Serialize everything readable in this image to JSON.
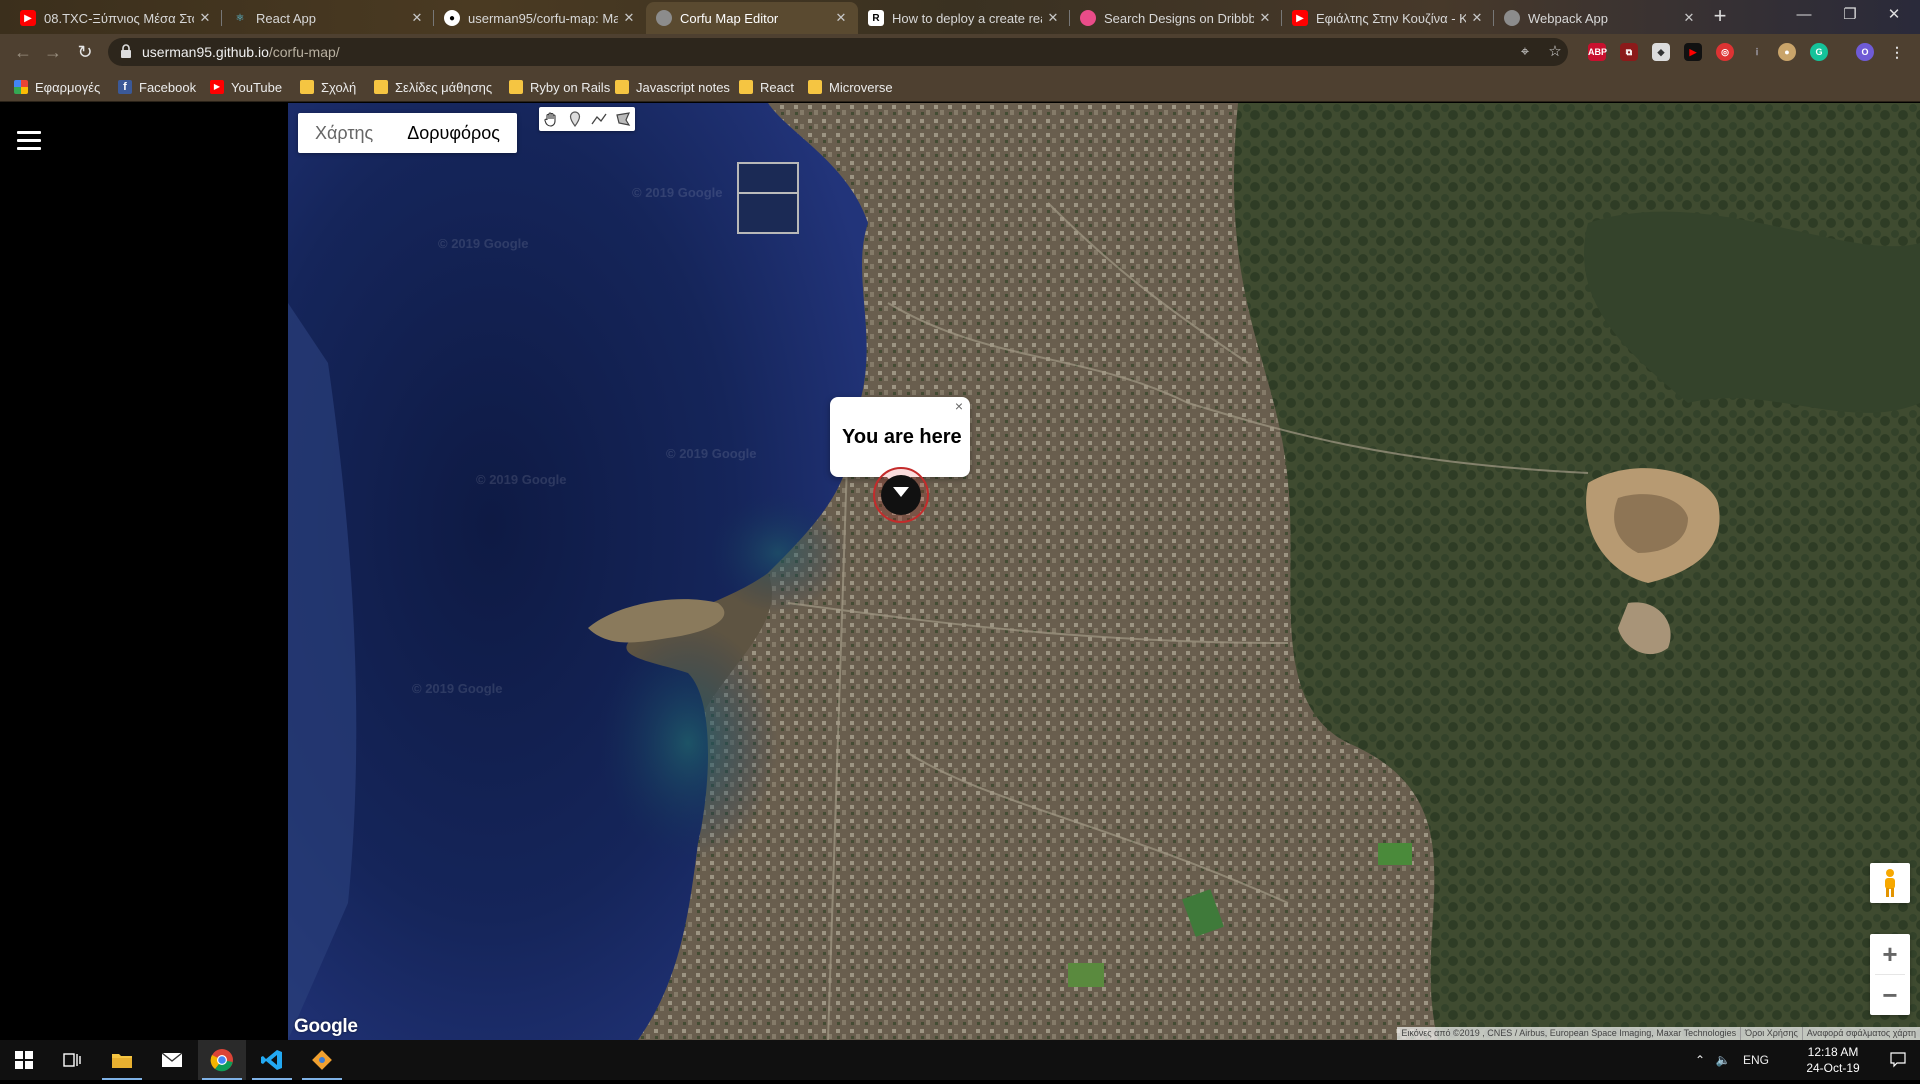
{
  "browser": {
    "tabs": [
      {
        "title": "08.TXC-Ξύπνιος Μέσα Στο",
        "favicon": "youtube-icon",
        "color": "#ff0000"
      },
      {
        "title": "React App",
        "favicon": "react-icon",
        "color": "#61dafb"
      },
      {
        "title": "userman95/corfu-map: Ma",
        "favicon": "github-icon",
        "color": "#ffffff"
      },
      {
        "title": "Corfu Map Editor",
        "favicon": "globe-icon",
        "color": "#8c8c8c"
      },
      {
        "title": "How to deploy a create rea",
        "favicon": "medium-icon",
        "color": "#000000"
      },
      {
        "title": "Search Designs on Dribbble",
        "favicon": "dribbble-icon",
        "color": "#ea4c89"
      },
      {
        "title": "Εφιάλτης Στην Κουζίνα - K",
        "favicon": "youtube-icon",
        "color": "#ff0000"
      },
      {
        "title": "Webpack App",
        "favicon": "globe-icon",
        "color": "#8c8c8c"
      }
    ],
    "active_tab_index": 3,
    "url_host": "userman95.github.io",
    "url_path": "/corfu-map/",
    "bookmarks": [
      {
        "label": "Εφαρμογές",
        "icon": "apps-grid-icon"
      },
      {
        "label": "Facebook",
        "icon": "facebook-icon"
      },
      {
        "label": "YouTube",
        "icon": "youtube-icon"
      },
      {
        "label": "Σχολή",
        "icon": "folder-icon"
      },
      {
        "label": "Σελίδες μάθησης",
        "icon": "folder-icon"
      },
      {
        "label": "Ryby on Rails",
        "icon": "folder-icon"
      },
      {
        "label": "Javascript notes",
        "icon": "folder-icon"
      },
      {
        "label": "React",
        "icon": "folder-icon"
      },
      {
        "label": "Microverse",
        "icon": "folder-icon"
      }
    ],
    "extensions": [
      "ABP",
      "pdf",
      "cube",
      "yt",
      "red",
      "i",
      "cookie",
      "G",
      "O"
    ]
  },
  "map": {
    "type_control": {
      "map_label": "Χάρτης",
      "satellite_label": "Δορυφόρος",
      "active": "satellite"
    },
    "draw_tools": [
      "hand-icon",
      "marker-icon",
      "polyline-icon",
      "polygon-icon"
    ],
    "info_window": {
      "text": "You are here",
      "close": "×"
    },
    "watermark": "© 2019 Google",
    "logo": "Google",
    "attribution": "Εικόνες από ©2019 , CNES / Airbus, European Space Imaging, Maxar Technologies",
    "terms": "Όροι Χρήσης",
    "report": "Αναφορά σφάλματος χάρτη",
    "zoom_in": "+",
    "zoom_out": "−"
  },
  "taskbar": {
    "language": "ENG",
    "time": "12:18 AM",
    "date": "24-Oct-19"
  },
  "colors": {
    "sea": "#12204a",
    "land": "#5a4f3c",
    "forest": "#3b4a2c",
    "chrome": "#4e4030"
  }
}
